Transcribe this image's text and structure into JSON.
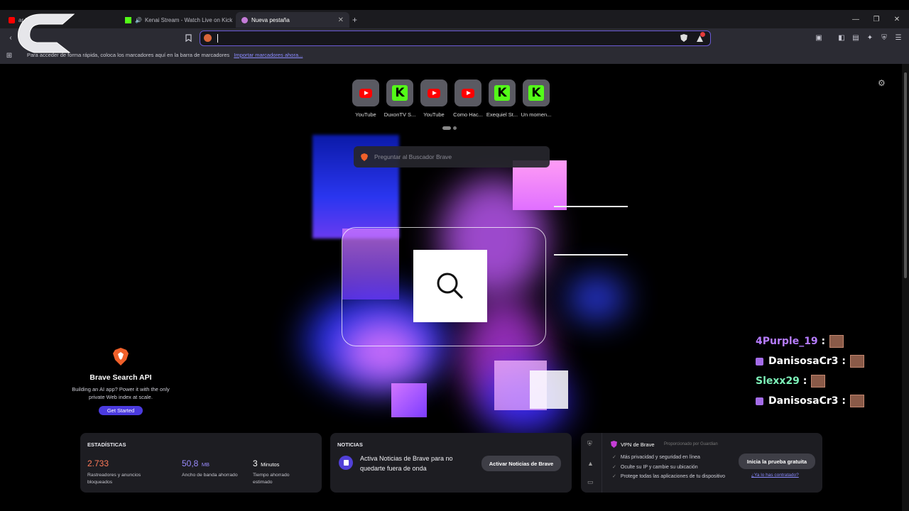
{
  "tabs": [
    {
      "title": "ar k...",
      "icon": "youtube-icon"
    },
    {
      "title": "Kenai Stream - Watch Live on Kick",
      "icon": "kick-icon"
    },
    {
      "title": "Nueva pestaña",
      "icon": "brave-icon"
    }
  ],
  "bookmarks_bar": {
    "hint": "Para acceder de forma rápida, coloca los marcadores aquí en la barra de marcadores",
    "import_link": "Importar marcadores ahora..."
  },
  "top_sites": [
    {
      "label": "YouTube",
      "icon": "youtube-icon"
    },
    {
      "label": "DuxonTV S...",
      "icon": "kick-icon"
    },
    {
      "label": "YouTube",
      "icon": "youtube-icon"
    },
    {
      "label": "Como Hac...",
      "icon": "youtube-icon"
    },
    {
      "label": "Exequiel St...",
      "icon": "kick-icon"
    },
    {
      "label": "Un momen...",
      "icon": "kick-icon"
    }
  ],
  "search": {
    "placeholder": "Preguntar al Buscador Brave"
  },
  "api_promo": {
    "title": "Brave Search API",
    "description": "Building an AI app? Power it with the only private Web index at scale.",
    "button": "Get Started"
  },
  "stats": {
    "title": "ESTADÍSTICAS",
    "items": [
      {
        "value": "2.733",
        "unit": "",
        "label": "Rastreadores y anuncios bloqueados",
        "color": "#ff7a59"
      },
      {
        "value": "50,8",
        "unit": "MB",
        "label": "Ancho de banda ahorrado",
        "color": "#9b8cff"
      },
      {
        "value": "3",
        "unit": "Minutos",
        "label": "Tiempo ahorrado estimado",
        "color": "#ffffff"
      }
    ]
  },
  "news": {
    "title": "NOTICIAS",
    "text": "Activa Noticias de Brave para no quedarte fuera de onda",
    "button": "Activar Noticias de Brave"
  },
  "vpn": {
    "title": "VPN de Brave",
    "provider": "Proporcionado por Guardian",
    "lines": [
      "Más privacidad y seguridad en línea",
      "Oculte su IP y cambie su ubicación",
      "Protege todas las aplicaciones de tu dispositivo"
    ],
    "button": "Inicia la prueba gratuita",
    "link": "¿Ya lo has contratado?"
  },
  "chat_overlay": [
    {
      "user": "4Purple_19",
      "color": "#b67cff",
      "badge": false
    },
    {
      "user": "DanisosaCr3",
      "color": "#ffffff",
      "badge": true
    },
    {
      "user": "Slexx29",
      "color": "#7df0b8",
      "badge": false
    },
    {
      "user": "DanisosaCr3",
      "color": "#ffffff",
      "badge": true
    }
  ],
  "accent_color": "#6b5bd6"
}
